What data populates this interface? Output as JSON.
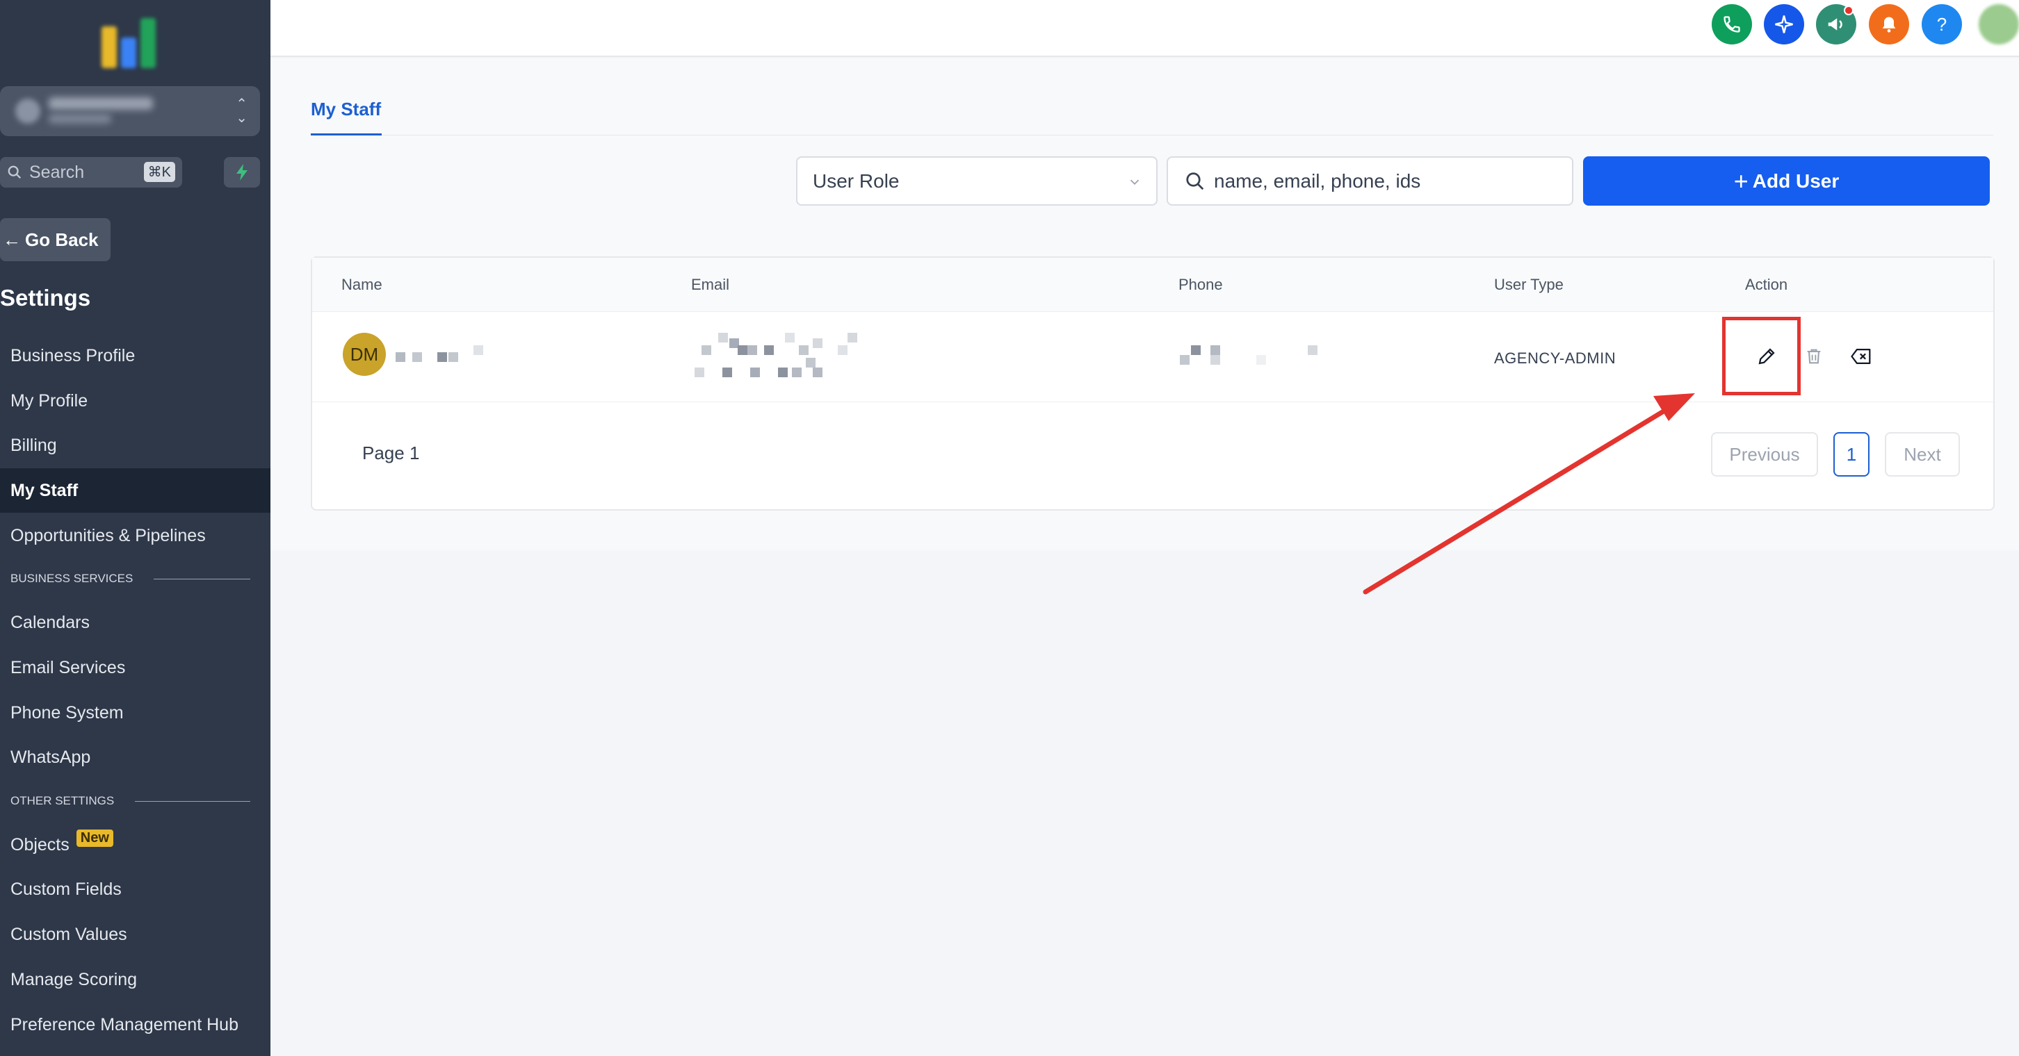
{
  "sidebar": {
    "search": {
      "placeholder": "Search",
      "shortcut": "⌘K"
    },
    "go_back": "Go Back",
    "title": "Settings",
    "items": [
      {
        "label": "Business Profile"
      },
      {
        "label": "My Profile"
      },
      {
        "label": "Billing"
      },
      {
        "label": "My Staff",
        "active": true
      },
      {
        "label": "Opportunities & Pipelines"
      }
    ],
    "section_business": "BUSINESS SERVICES",
    "business_items": [
      {
        "label": "Calendars"
      },
      {
        "label": "Email Services"
      },
      {
        "label": "Phone System"
      },
      {
        "label": "WhatsApp"
      }
    ],
    "section_other": "OTHER SETTINGS",
    "other_items": [
      {
        "label": "Objects",
        "badge": "New"
      },
      {
        "label": "Custom Fields"
      },
      {
        "label": "Custom Values"
      },
      {
        "label": "Manage Scoring"
      },
      {
        "label": "Preference Management Hub"
      }
    ]
  },
  "topbar": {
    "icons": [
      "phone-icon",
      "sparkle-icon",
      "megaphone-icon",
      "bell-icon",
      "help-icon"
    ],
    "colors": {
      "phone": "#0e9f5c",
      "sparkle": "#1557e8",
      "megaphone": "#2f8f74",
      "bell": "#f26d1b",
      "help": "#1e88f0"
    }
  },
  "main": {
    "tab": "My Staff",
    "filter": {
      "selected": "User Role"
    },
    "search": {
      "placeholder": "name, email, phone, ids"
    },
    "add_user": "Add User",
    "table": {
      "columns": [
        "Name",
        "Email",
        "Phone",
        "User Type",
        "Action"
      ],
      "rows": [
        {
          "initials": "DM",
          "user_type": "AGENCY-ADMIN"
        }
      ]
    },
    "pagination": {
      "label": "Page 1",
      "previous": "Previous",
      "current": "1",
      "next": "Next"
    }
  },
  "colors": {
    "accent": "#155eef",
    "sidebar": "#2e3849",
    "highlight": "#e3342f"
  }
}
